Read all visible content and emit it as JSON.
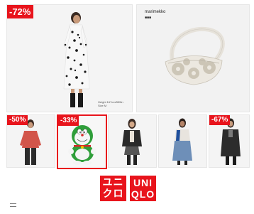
{
  "hero": [
    {
      "badge": "-72%",
      "caption_line1": "Height 167cm/5ft5in",
      "caption_line2": "Size M"
    },
    {
      "brand_line1": "marimekko",
      "brand_line2": "■■■"
    }
  ],
  "products": [
    {
      "badge": "-50%",
      "selected": false
    },
    {
      "badge": "-33%",
      "selected": true
    },
    {
      "badge": "",
      "selected": false
    },
    {
      "badge": "",
      "selected": false
    },
    {
      "badge": "-67%",
      "selected": false
    }
  ],
  "brand": {
    "logo_katakana_line1": "ユニ",
    "logo_katakana_line2": "クロ",
    "logo_latin_line1": "UNI",
    "logo_latin_line2": "QLO"
  },
  "colors": {
    "accent": "#e8141c",
    "selection_border": "#e8141c"
  },
  "icons": {
    "menu": "menu-icon"
  }
}
